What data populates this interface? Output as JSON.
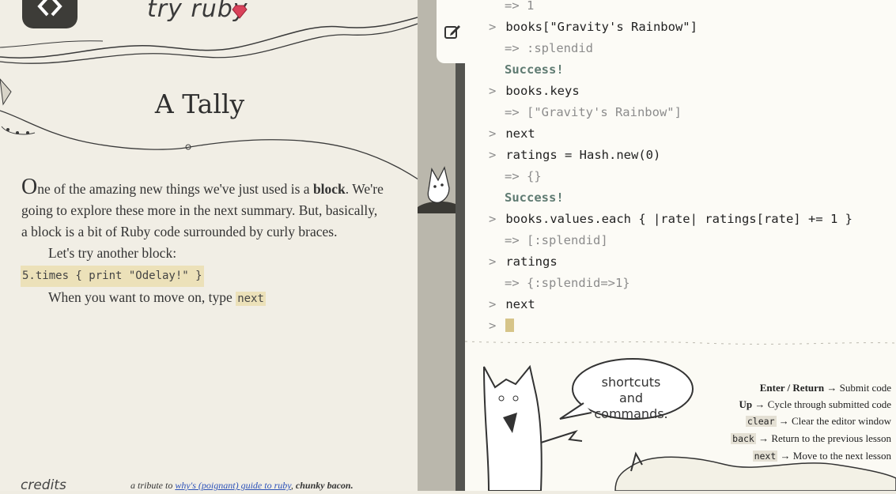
{
  "app": {
    "brand": "try ruby"
  },
  "lesson": {
    "title": "A Tally",
    "p1_dropcap": "O",
    "p1_before": "ne of the amazing new things we've just used is a ",
    "p1_bold": "block",
    "p1_after": ". We're going to explore these more in the next summary. But, basically, a block is a bit of Ruby code surrounded by curly braces.",
    "p2": "Let's try another block:",
    "code_example": "5.times { print \"Odelay!\" }",
    "p3": "When you want to move on, type ",
    "p3_code": "next"
  },
  "footer": {
    "credits": "credits",
    "tribute_before": "a tribute to ",
    "tribute_link": "why's (poignant) guide to ruby",
    "tribute_mid": ", ",
    "tribute_bold": "chunky bacon."
  },
  "console": {
    "lines": [
      {
        "kind": "result",
        "text": "=> 1"
      },
      {
        "kind": "input",
        "prompt": ">",
        "text": "books[\"Gravity's Rainbow\"]"
      },
      {
        "kind": "result",
        "text": "=> :splendid"
      },
      {
        "kind": "success",
        "text": "Success!"
      },
      {
        "kind": "input",
        "prompt": ">",
        "text": "books.keys"
      },
      {
        "kind": "result",
        "text": "=> [\"Gravity's Rainbow\"]"
      },
      {
        "kind": "input",
        "prompt": ">",
        "text": "next"
      },
      {
        "kind": "input",
        "prompt": ">",
        "text": "ratings = Hash.new(0)"
      },
      {
        "kind": "result",
        "text": "=> {}"
      },
      {
        "kind": "success",
        "text": "Success!"
      },
      {
        "kind": "input",
        "prompt": ">",
        "text": "books.values.each { |rate| ratings[rate] += 1 }"
      },
      {
        "kind": "result",
        "text": "=> [:splendid]"
      },
      {
        "kind": "input",
        "prompt": ">",
        "text": "ratings"
      },
      {
        "kind": "result",
        "text": "=> {:splendid=>1}"
      },
      {
        "kind": "input",
        "prompt": ">",
        "text": "next"
      }
    ],
    "active_prompt": ">"
  },
  "help": {
    "bubble_line1": "shortcuts",
    "bubble_line2": "and",
    "bubble_line3": "commands.",
    "shortcuts": [
      {
        "key": "Enter / Return",
        "key_style": "bold",
        "desc": "Submit code"
      },
      {
        "key": "Up",
        "key_style": "bold",
        "desc": "Cycle through submitted code"
      },
      {
        "key": "clear",
        "key_style": "code",
        "desc": "Clear the editor window"
      },
      {
        "key": "back",
        "key_style": "code",
        "desc": "Return to the previous lesson"
      },
      {
        "key": "next",
        "key_style": "code",
        "desc": "Move to the next lesson"
      }
    ],
    "arrow": "→"
  },
  "colors": {
    "panel_bg": "#f1eee5",
    "console_bg": "#fcfbf6",
    "code_highlight": "#ece1b9",
    "success": "#5f7b72",
    "ruby": "#d9425a"
  },
  "icons": [
    "code-brackets-icon",
    "ruby-gem-icon",
    "edit-icon"
  ]
}
